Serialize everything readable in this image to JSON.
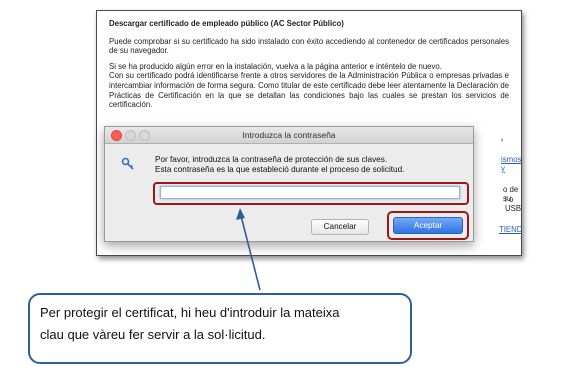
{
  "page": {
    "heading": "Descargar certificado de empleado público (AC Sector Público)",
    "para1": "Puede comprobar si su certificado ha sido instalado con éxito accediendo al contenedor de certificados personales de su navegador.",
    "para2_line1": "Si se ha producido algún error en la instalación, vuelva a la página anterior e inténtelo de nuevo.",
    "para2_rest": "Con su certificado podrá identificarse frente a otros servidores de la Administración Pública o empresas privadas e intercambiar información de forma segura. Como titular de este certificado debe leer atentamente la Declaración de Prácticas de Certificación en la que se detallan las condiciones bajo las cuales se prestan los servicios de certificación.",
    "right_fragments": {
      "link1": "ismos y",
      "text1": "o de su",
      "text2": "l o USB",
      "link2": "TIENDA"
    }
  },
  "dialog": {
    "title": "Introduzca la contraseña",
    "message_line1": "Por favor, introduzca la contraseña de protección de sus claves.",
    "message_line2": "Esta contraseña es la que estableció durante el proceso de solicitud.",
    "password_value": "",
    "cancel_label": "Cancelar",
    "ok_label": "Aceptar",
    "icon": "key-icon"
  },
  "callout": {
    "line1": "Per protegir el certificat, hi heu d'introduir la mateixa",
    "line2": "clau que vàreu fer servir a la sol·licitud."
  },
  "colors": {
    "highlight": "#a01616",
    "accent_button": "#2f73e0",
    "callout_border": "#2f5f9a"
  }
}
